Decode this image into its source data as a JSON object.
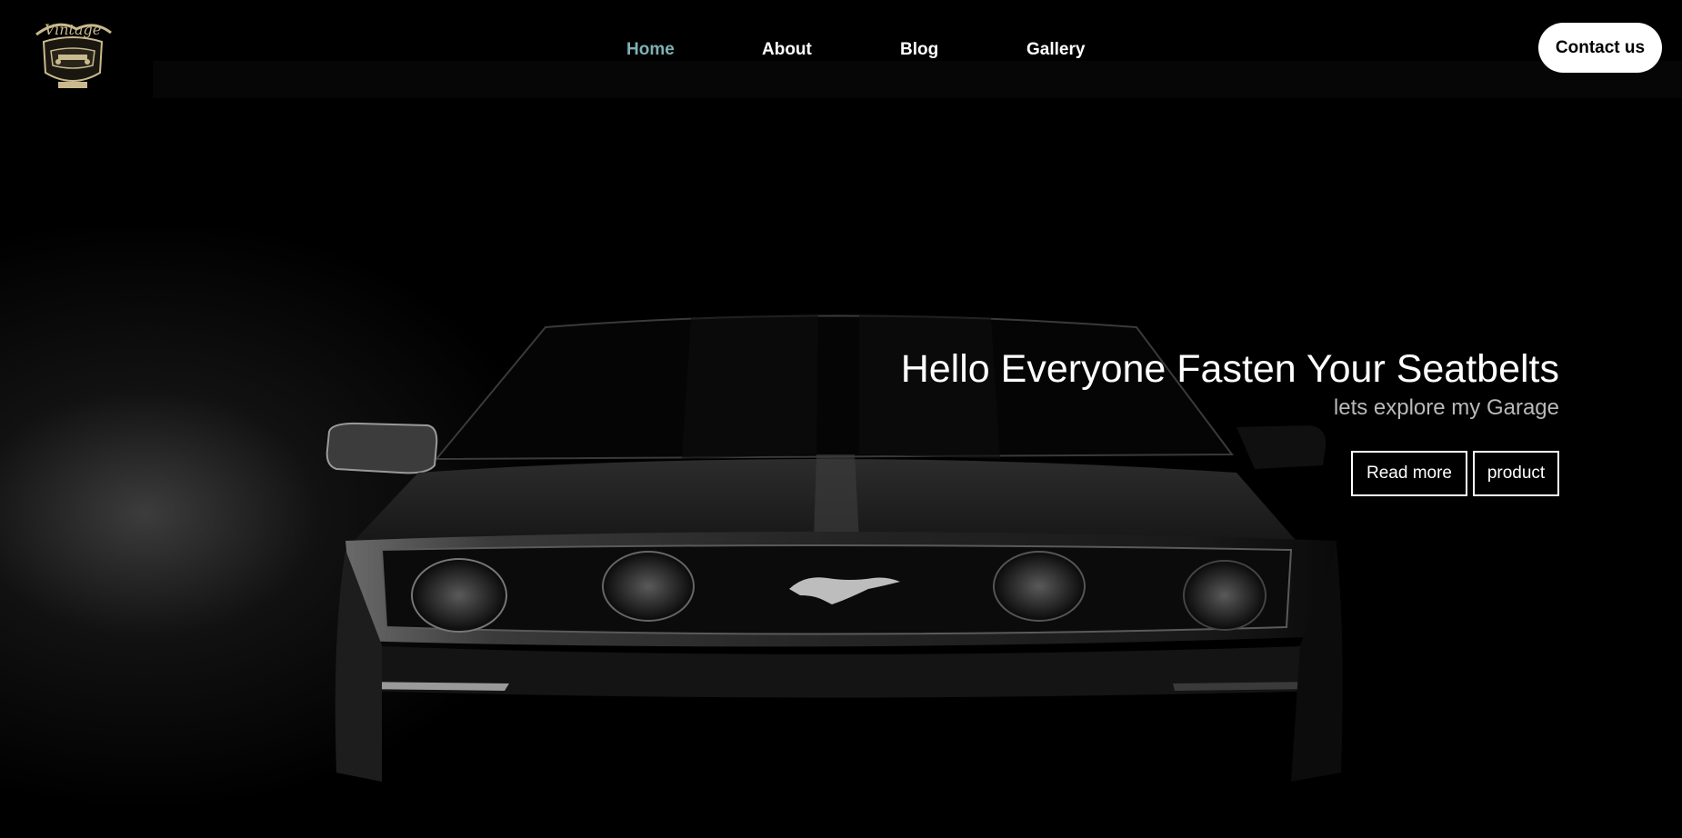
{
  "logo": {
    "alt": "Vintage"
  },
  "nav": {
    "items": [
      {
        "label": "Home",
        "active": true
      },
      {
        "label": "About",
        "active": false
      },
      {
        "label": "Blog",
        "active": false
      },
      {
        "label": "Gallery",
        "active": false
      }
    ],
    "contact_label": "Contact us"
  },
  "hero": {
    "title": "Hello Everyone Fasten Your Seatbelts",
    "subtitle": "lets explore my Garage",
    "read_more_label": "Read more",
    "product_label": "product"
  },
  "colors": {
    "background": "#000000",
    "nav_active": "#7fb0b5",
    "nav_text": "#ffffff",
    "contact_bg": "#ffffff",
    "subtitle": "#b9b9b9"
  }
}
